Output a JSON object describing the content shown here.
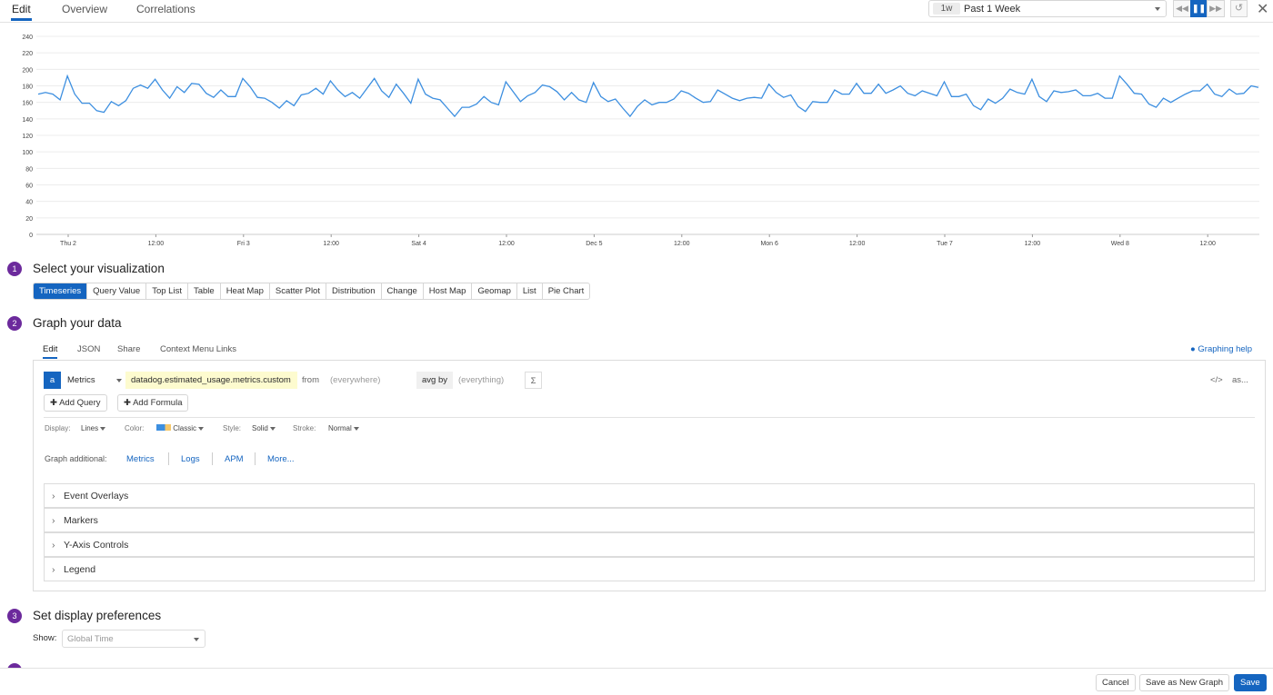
{
  "top_tabs": [
    "Edit",
    "Overview",
    "Correlations"
  ],
  "time_selector": {
    "badge": "1w",
    "label": "Past 1 Week"
  },
  "controls": {
    "rewind": "rewind-icon",
    "pause": "pause-icon",
    "forward": "fast-forward-icon",
    "reset": "undo-icon",
    "close": "close-icon"
  },
  "colors": {
    "accent": "#1565c0",
    "series": "#3d8fe0",
    "step": "#6c2a9c",
    "query_highlight": "#fdfbcf"
  },
  "chart_data": {
    "type": "line",
    "y_ticks": [
      "0",
      "20",
      "40",
      "60",
      "80",
      "100",
      "120",
      "140",
      "160",
      "180",
      "200",
      "220",
      "240"
    ],
    "ylim": [
      0,
      240
    ],
    "x_ticks": [
      "Thu 2",
      "12:00",
      "Fri 3",
      "12:00",
      "Sat 4",
      "12:00",
      "Dec 5",
      "12:00",
      "Mon 6",
      "12:00",
      "Tue 7",
      "12:00",
      "Wed 8",
      "12:00"
    ],
    "grid": true,
    "series": [
      {
        "values": [
          170,
          172,
          170,
          163,
          192,
          170,
          159,
          159,
          150,
          148,
          161,
          156,
          162,
          177,
          181,
          177,
          188,
          175,
          165,
          179,
          172,
          183,
          182,
          171,
          166,
          175,
          167,
          167,
          189,
          179,
          166,
          165,
          160,
          153,
          162,
          156,
          169,
          171,
          177,
          170,
          186,
          175,
          167,
          172,
          165,
          177,
          189,
          174,
          166,
          182,
          171,
          159,
          188,
          170,
          165,
          163,
          153,
          143,
          154,
          154,
          158,
          167,
          160,
          157,
          185,
          173,
          161,
          168,
          172,
          181,
          179,
          173,
          163,
          172,
          163,
          160,
          184,
          167,
          161,
          164,
          153,
          143,
          155,
          163,
          157,
          160,
          160,
          164,
          174,
          171,
          165,
          160,
          161,
          175,
          170,
          165,
          162,
          165,
          166,
          165,
          182,
          172,
          166,
          169,
          155,
          149,
          161,
          160,
          160,
          175,
          170,
          170,
          183,
          171,
          171,
          182,
          171,
          175,
          180,
          171,
          168,
          174,
          171,
          168,
          185,
          167,
          167,
          170,
          156,
          151,
          164,
          159,
          165,
          176,
          172,
          170,
          188,
          167,
          161,
          174,
          172,
          173,
          175,
          168,
          168,
          171,
          165,
          165,
          192,
          182,
          171,
          170,
          158,
          154,
          165,
          160,
          165,
          170,
          174,
          174,
          182,
          170,
          167,
          176,
          170,
          171,
          180,
          178
        ]
      }
    ]
  },
  "steps": [
    {
      "num": "1",
      "title": "Select your visualization"
    },
    {
      "num": "2",
      "title": "Graph your data"
    },
    {
      "num": "3",
      "title": "Set display preferences"
    }
  ],
  "visualizations": [
    "Timeseries",
    "Query Value",
    "Top List",
    "Table",
    "Heat Map",
    "Scatter Plot",
    "Distribution",
    "Change",
    "Host Map",
    "Geomap",
    "List",
    "Pie Chart"
  ],
  "graph_tabs": [
    "Edit",
    "JSON",
    "Share",
    "Context Menu Links"
  ],
  "graphing_help": "Graphing help",
  "query": {
    "letter": "a",
    "source": "Metrics",
    "metric": "datadog.estimated_usage.metrics.custom",
    "from_label": "from",
    "from_placeholder": "(everywhere)",
    "avg_label": "avg by",
    "avg_placeholder": "(everything)",
    "sigma": "Σ",
    "code": "</>",
    "as": "as..."
  },
  "add_query": "Add Query",
  "add_formula": "Add Formula",
  "options": {
    "display_label": "Display:",
    "display": "Lines",
    "color_label": "Color:",
    "color": "Classic",
    "style_label": "Style:",
    "style": "Solid",
    "stroke_label": "Stroke:",
    "stroke": "Normal"
  },
  "graph_additional": {
    "label": "Graph additional:",
    "links": [
      "Metrics",
      "Logs",
      "APM",
      "More..."
    ]
  },
  "accordions": [
    "Event Overlays",
    "Markers",
    "Y-Axis Controls",
    "Legend"
  ],
  "show": {
    "label": "Show:",
    "value": "Global Time"
  },
  "footer": {
    "cancel": "Cancel",
    "save_new": "Save as New Graph",
    "save": "Save"
  }
}
